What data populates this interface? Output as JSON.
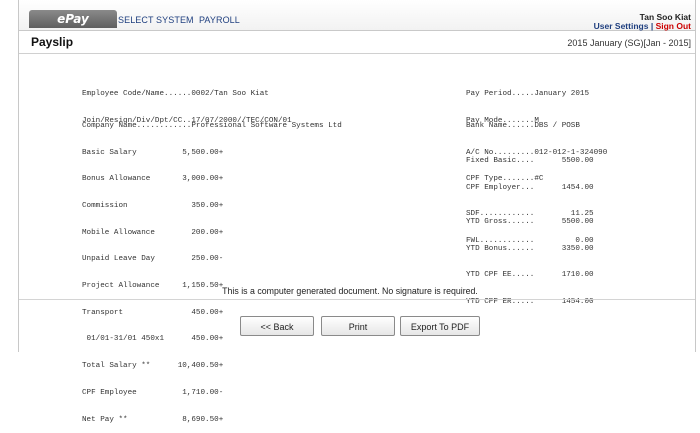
{
  "header": {
    "logo": "ePay",
    "nav": [
      "SELECT SYSTEM",
      "PAYROLL"
    ],
    "user_name": "Tan Soo Kiat",
    "user_settings": "User Settings",
    "separator": "|",
    "sign_out": "Sign Out"
  },
  "titlebar": {
    "title": "Payslip",
    "period": "2015 January (SG)[Jan - 2015]"
  },
  "payslip": {
    "left_header": [
      "Employee Code/Name......0002/Tan Soo Kiat",
      "Join/Resign/Div/Dpt/CC..17/07/2000//TEC/CON/01"
    ],
    "left_body": [
      "Company Name............Professional Software Systems Ltd",
      "Basic Salary          5,500.00+",
      "Bonus Allowance       3,000.00+",
      "Commission              350.00+",
      "Mobile Allowance        200.00+",
      "Unpaid Leave Day        250.00-",
      "Project Allowance     1,150.50+",
      "Transport               450.00+",
      " 01/01-31/01 450x1      450.00+",
      "Total Salary **      10,400.50+",
      "CPF Employee          1,710.00-",
      "Net Pay **            8,690.50+"
    ],
    "right_header": [
      "Pay Period.....January 2015",
      "Pay Mode.......M"
    ],
    "right_bank": [
      "Bank Name......DBS / POSB",
      "A/C No.........012-012-1-324090",
      "CPF Type.......#C"
    ],
    "right_cpf": [
      "Fixed Basic....      5500.00",
      "CPF Employer...      1454.00",
      "SDF............        11.25",
      "FWL............         0.00"
    ],
    "right_ytd": [
      "YTD Gross......      5500.00",
      "YTD Bonus......      3350.00",
      "YTD CPF EE.....      1710.00",
      "YTD CPF ER.....      1454.00"
    ]
  },
  "footer": {
    "note": "This is a computer generated document. No signature is required.",
    "buttons": {
      "back": "<< Back",
      "print": "Print",
      "pdf": "Export To PDF"
    }
  }
}
